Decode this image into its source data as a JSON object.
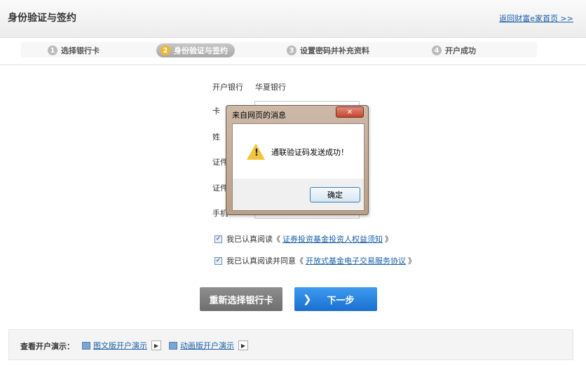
{
  "header": {
    "title": "身份验证与签约",
    "home_link": "返回财富e家首页 >>"
  },
  "steps": [
    {
      "num": "1",
      "label": "选择银行卡"
    },
    {
      "num": "2",
      "label": "身份验证与签约"
    },
    {
      "num": "3",
      "label": "设置密码并补充资料"
    },
    {
      "num": "4",
      "label": "开户成功"
    }
  ],
  "form": {
    "bank_label": "开户银行",
    "bank_value": "华夏银行",
    "card_label": "卡",
    "name_label": "姓",
    "id_type_label": "证件",
    "id_no_label": "证件",
    "phone_label": "手机"
  },
  "agreements": [
    {
      "prefix": "我已认真阅读《",
      "link": "证券投资基金投资人权益须知",
      "suffix": "》"
    },
    {
      "prefix": "我已认真阅读并同意《",
      "link": "开放式基金电子交易服务协议",
      "suffix": "》"
    }
  ],
  "buttons": {
    "reselect": "重新选择银行卡",
    "next": "下一步"
  },
  "footer": {
    "label": "查看开户演示：",
    "demo_text": "图文版开户演示",
    "demo_anim": "动画版开户演示"
  },
  "dialog": {
    "title": "来自网页的消息",
    "message": "通联验证码发送成功！",
    "ok": "确定"
  }
}
